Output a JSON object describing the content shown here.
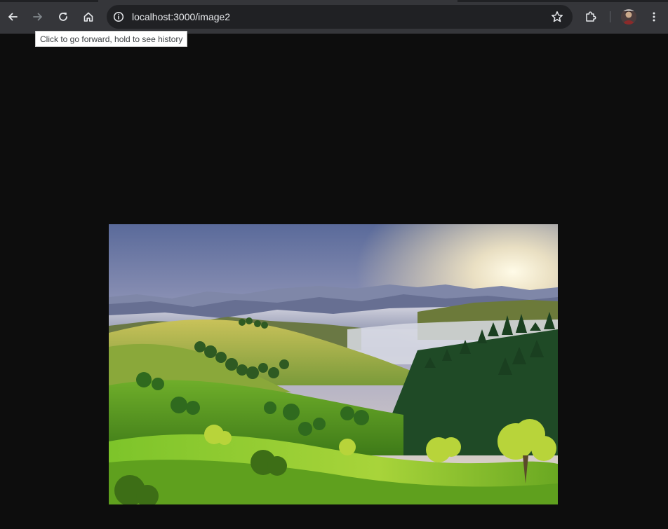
{
  "browser": {
    "url": "localhost:3000/image2",
    "buttons": {
      "back": "arrow-left-icon",
      "forward": "arrow-right-icon",
      "reload": "reload-icon",
      "home": "home-icon",
      "site_info": "info-icon",
      "bookmark": "star-icon",
      "extensions": "puzzle-icon",
      "menu": "kebab-menu-icon"
    },
    "tooltip": "Click to go forward, hold to see history"
  },
  "page": {
    "background": "#0d0d0d",
    "image": {
      "subject": "landscape-photo"
    }
  },
  "colors": {
    "toolbar": "#35363a",
    "omnibox": "#202124",
    "icon": "#e8eaed",
    "icon_disabled": "#80868b"
  }
}
